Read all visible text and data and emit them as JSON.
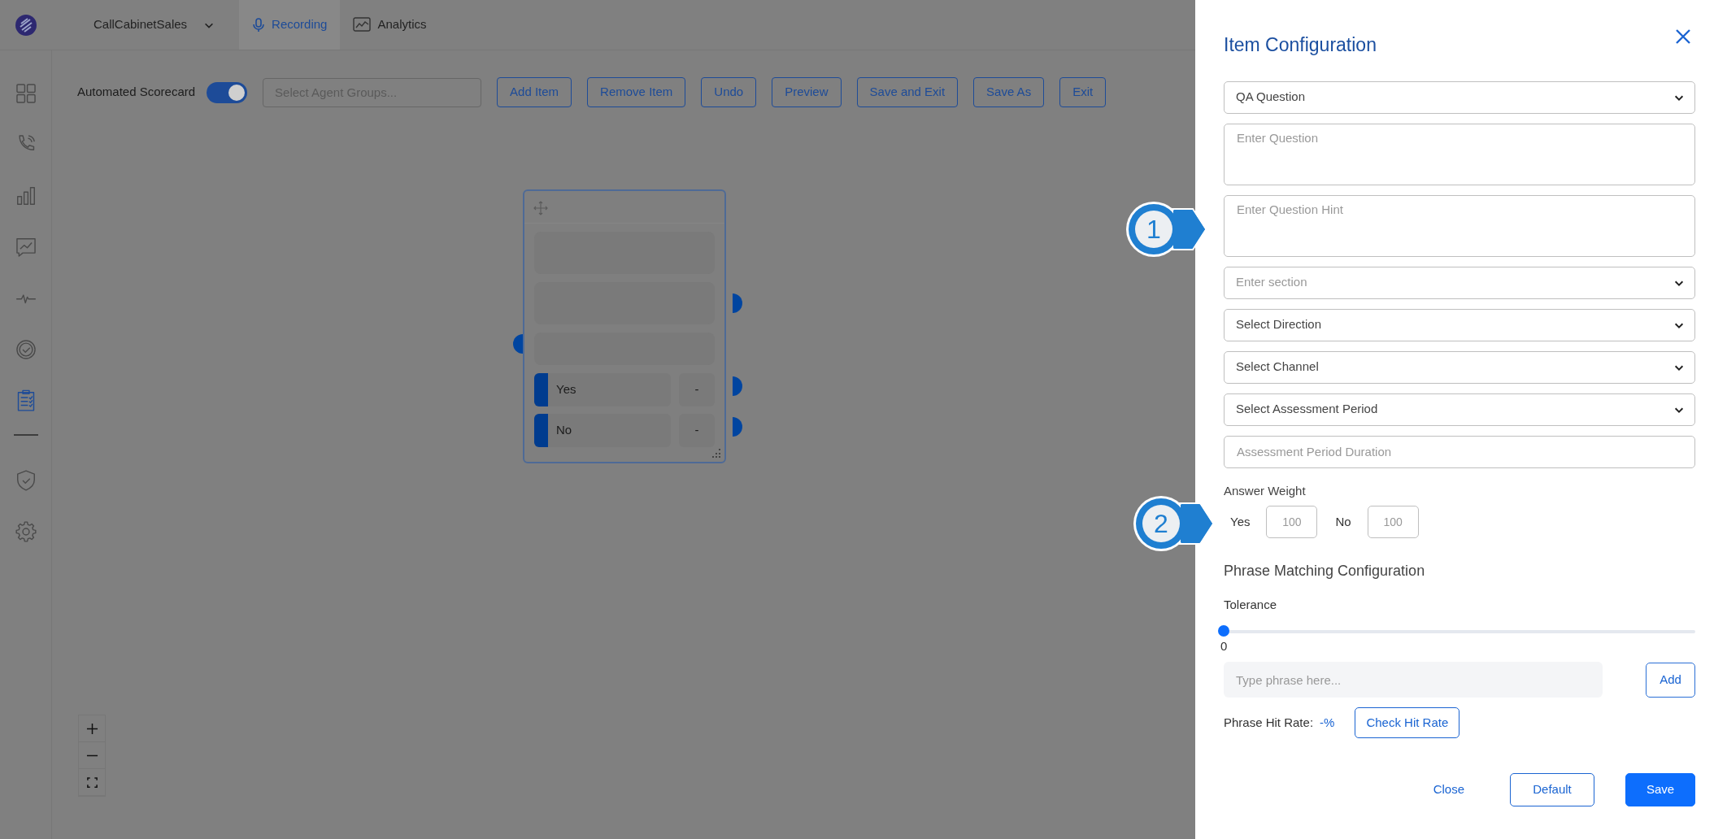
{
  "topbar": {
    "workspace": "CallCabinetSales",
    "tabs": [
      {
        "label": "Recording",
        "selected": true
      },
      {
        "label": "Analytics",
        "selected": false
      }
    ]
  },
  "sidebar": {
    "items": [
      {
        "selected": false
      },
      {
        "selected": false
      },
      {
        "selected": false
      },
      {
        "selected": false
      },
      {
        "selected": false
      },
      {
        "selected": false
      },
      {
        "selected": true
      },
      {
        "selected": false
      },
      {
        "selected": false
      }
    ]
  },
  "toolbar": {
    "toggle_label": "Automated Scorecard",
    "toggle_on": true,
    "agent_groups": {
      "placeholder": "Select Agent Groups..."
    },
    "buttons": [
      "Add Item",
      "Remove Item",
      "Undo",
      "Preview",
      "Save and Exit",
      "Save As",
      "Exit"
    ]
  },
  "node": {
    "answers": [
      {
        "label": "Yes",
        "weight": "-"
      },
      {
        "label": "No",
        "weight": "-"
      }
    ]
  },
  "panel": {
    "title": "Item Configuration",
    "fields": [
      {
        "kind": "select",
        "value": "QA Question"
      },
      {
        "kind": "textarea",
        "placeholder": "Enter Question"
      },
      {
        "kind": "textarea",
        "placeholder": "Enter Question Hint"
      },
      {
        "kind": "select",
        "placeholder": "Enter section"
      },
      {
        "kind": "select",
        "value": "Select Direction"
      },
      {
        "kind": "select",
        "value": "Select Channel"
      },
      {
        "kind": "select",
        "value": "Select Assessment Period"
      },
      {
        "kind": "input",
        "placeholder": "Assessment Period Duration"
      }
    ],
    "answer_weight": {
      "label": "Answer Weight",
      "weights": [
        {
          "label": "Yes",
          "placeholder": "100"
        },
        {
          "label": "No",
          "placeholder": "100"
        }
      ]
    },
    "phrase_matching": {
      "heading": "Phrase Matching Configuration",
      "tolerance_label": "Tolerance",
      "tolerance": {
        "level": 0
      },
      "tolerance_reading": "0",
      "phrase": {
        "placeholder": "Type phrase here..."
      },
      "add_button": "Add",
      "hit_rate_label": "Phrase Hit Rate:",
      "hit_rate": "-%",
      "check_button": "Check Hit Rate"
    },
    "footer": [
      {
        "kind": "link",
        "label": "Close"
      },
      {
        "kind": "outline",
        "label": "Default"
      },
      {
        "kind": "primary",
        "label": "Save"
      }
    ]
  },
  "callouts": [
    {
      "number": "1"
    },
    {
      "number": "2"
    }
  ]
}
